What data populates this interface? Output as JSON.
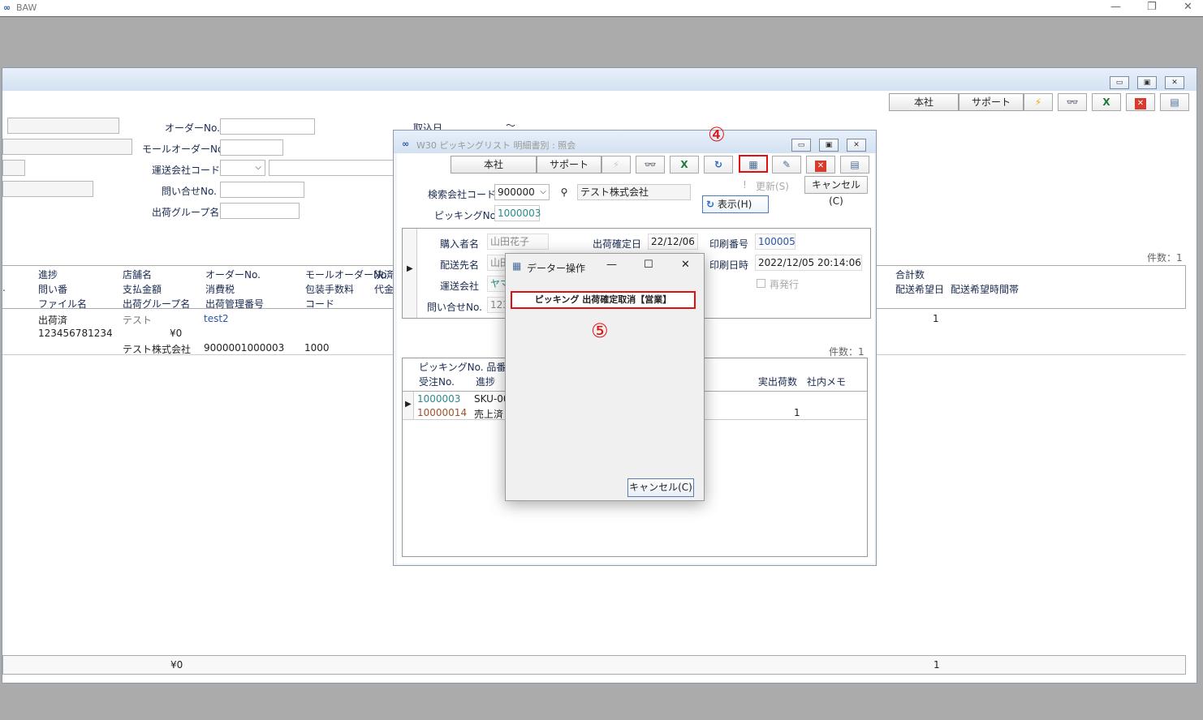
{
  "app": {
    "title": "BAW",
    "min": "—",
    "max": "❐",
    "close": "✕"
  },
  "main": {
    "toolbar": {
      "honsha": "本社",
      "support": "サポート"
    },
    "form": {
      "order_no_label": "オーダーNo.",
      "mall_order_no_label": "モールオーダーNo.",
      "carrier_code_label": "運送会社コード",
      "inquiry_no_label": "問い合せNo.",
      "ship_group_label": "出荷グループ名",
      "import_date_label": "取込日",
      "tilde": "〜"
    },
    "count_label": "件数：1",
    "grid": {
      "headers_row1": [
        "進捗",
        "店舗名",
        "オーダーNo.",
        "モールオーダーNo",
        "決済"
      ],
      "headers_row2": [
        "問い番",
        "支払金額",
        "消費税",
        "包装手数料",
        "代金"
      ],
      "headers_row3": [
        "ファイル名",
        "出荷グループ名",
        "出荷管理番号",
        "コード"
      ],
      "right_headers": [
        "合計数",
        "配送希望日",
        "配送希望時間帯"
      ],
      "left_dot": ".",
      "row": {
        "status": "出荷済",
        "shop": "テスト",
        "order_no": "test2",
        "inquiry": "123456781234",
        "payment": "¥0",
        "company": "テスト株式会社",
        "ship_mgmt_no": "9000001000003",
        "code": "1000",
        "total": "1"
      },
      "footer": {
        "payment": "¥0",
        "total": "1"
      }
    }
  },
  "w30": {
    "title": "W30 ピッキングリスト 明細書別 : 照会",
    "toolbar": {
      "honsha": "本社",
      "support": "サポート"
    },
    "update_label": "更新(S)",
    "cancel_label": "キャンセル(C)",
    "search_company_label": "検索会社コード",
    "search_company_value": "900000",
    "company_name": "テスト株式会社",
    "picking_no_label": "ピッキングNo.",
    "picking_no_value": "1000003",
    "display_label": "表示(H)",
    "detail": {
      "buyer_label": "購入者名",
      "buyer_value": "山田花子",
      "ship_to_label": "配送先名",
      "ship_to_value": "山田",
      "carrier_label": "運送会社",
      "carrier_value": "ヤマ",
      "inquiry_label": "問い合せNo.",
      "inquiry_value": "123",
      "ship_confirm_label": "出荷確定日",
      "ship_confirm_value": "22/12/06",
      "print_no_label": "印刷番号",
      "print_no_value": "100005",
      "print_dt_label": "印刷日時",
      "print_dt_value": "2022/12/05 20:14:06",
      "reissue_label": "再発行"
    },
    "count_label": "件数：1",
    "grid": {
      "h1": "ピッキングNo. 品番",
      "h2": "受注No.",
      "h3": "進捗",
      "h_actual": "実出荷数",
      "h_memo": "社内メモ",
      "r1_picking": "1000003",
      "r1_sku": "SKU-00",
      "r2_order": "10000014",
      "r2_status": "売上済",
      "actual": "1"
    }
  },
  "popup": {
    "title": "データー操作",
    "action_label": "ピッキング 出荷確定取消【営業】",
    "cancel_label": "キャンセル(C)"
  },
  "markers": {
    "step4": "④",
    "step5": "⑤"
  }
}
